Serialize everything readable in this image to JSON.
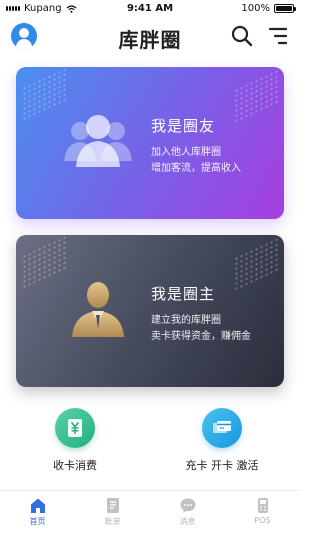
{
  "status_bar": {
    "carrier": "Kupang",
    "time": "9:41 AM",
    "battery": "100%"
  },
  "header": {
    "title": "库胖圈"
  },
  "cards": [
    {
      "title": "我是圈友",
      "line1": "加入他人库胖圈",
      "line2": "增加客流，提高收入"
    },
    {
      "title": "我是圈主",
      "line1": "建立我的库胖圈",
      "line2": "卖卡获得资金，赚佣金"
    }
  ],
  "actions": [
    {
      "label": "收卡消费",
      "icon": "card-consume-icon"
    },
    {
      "label": "充卡 开卡 激活",
      "icon": "card-topup-icon"
    }
  ],
  "tabs": [
    {
      "label": "首页",
      "icon": "home-icon",
      "active": true
    },
    {
      "label": "账单",
      "icon": "bill-icon",
      "active": false
    },
    {
      "label": "消息",
      "icon": "message-icon",
      "active": false
    },
    {
      "label": "POS",
      "icon": "pos-icon",
      "active": false
    }
  ],
  "colors": {
    "accent": "#2f6fe0",
    "friend_card_gradient": [
      "#4a8ff0",
      "#a73ee0"
    ],
    "owner_card_gradient": [
      "#6c6f83",
      "#2a2e3c"
    ],
    "consume_green": "#23b07e",
    "topup_blue": "#1997e0",
    "inactive_tab": "#b5b5b5"
  }
}
